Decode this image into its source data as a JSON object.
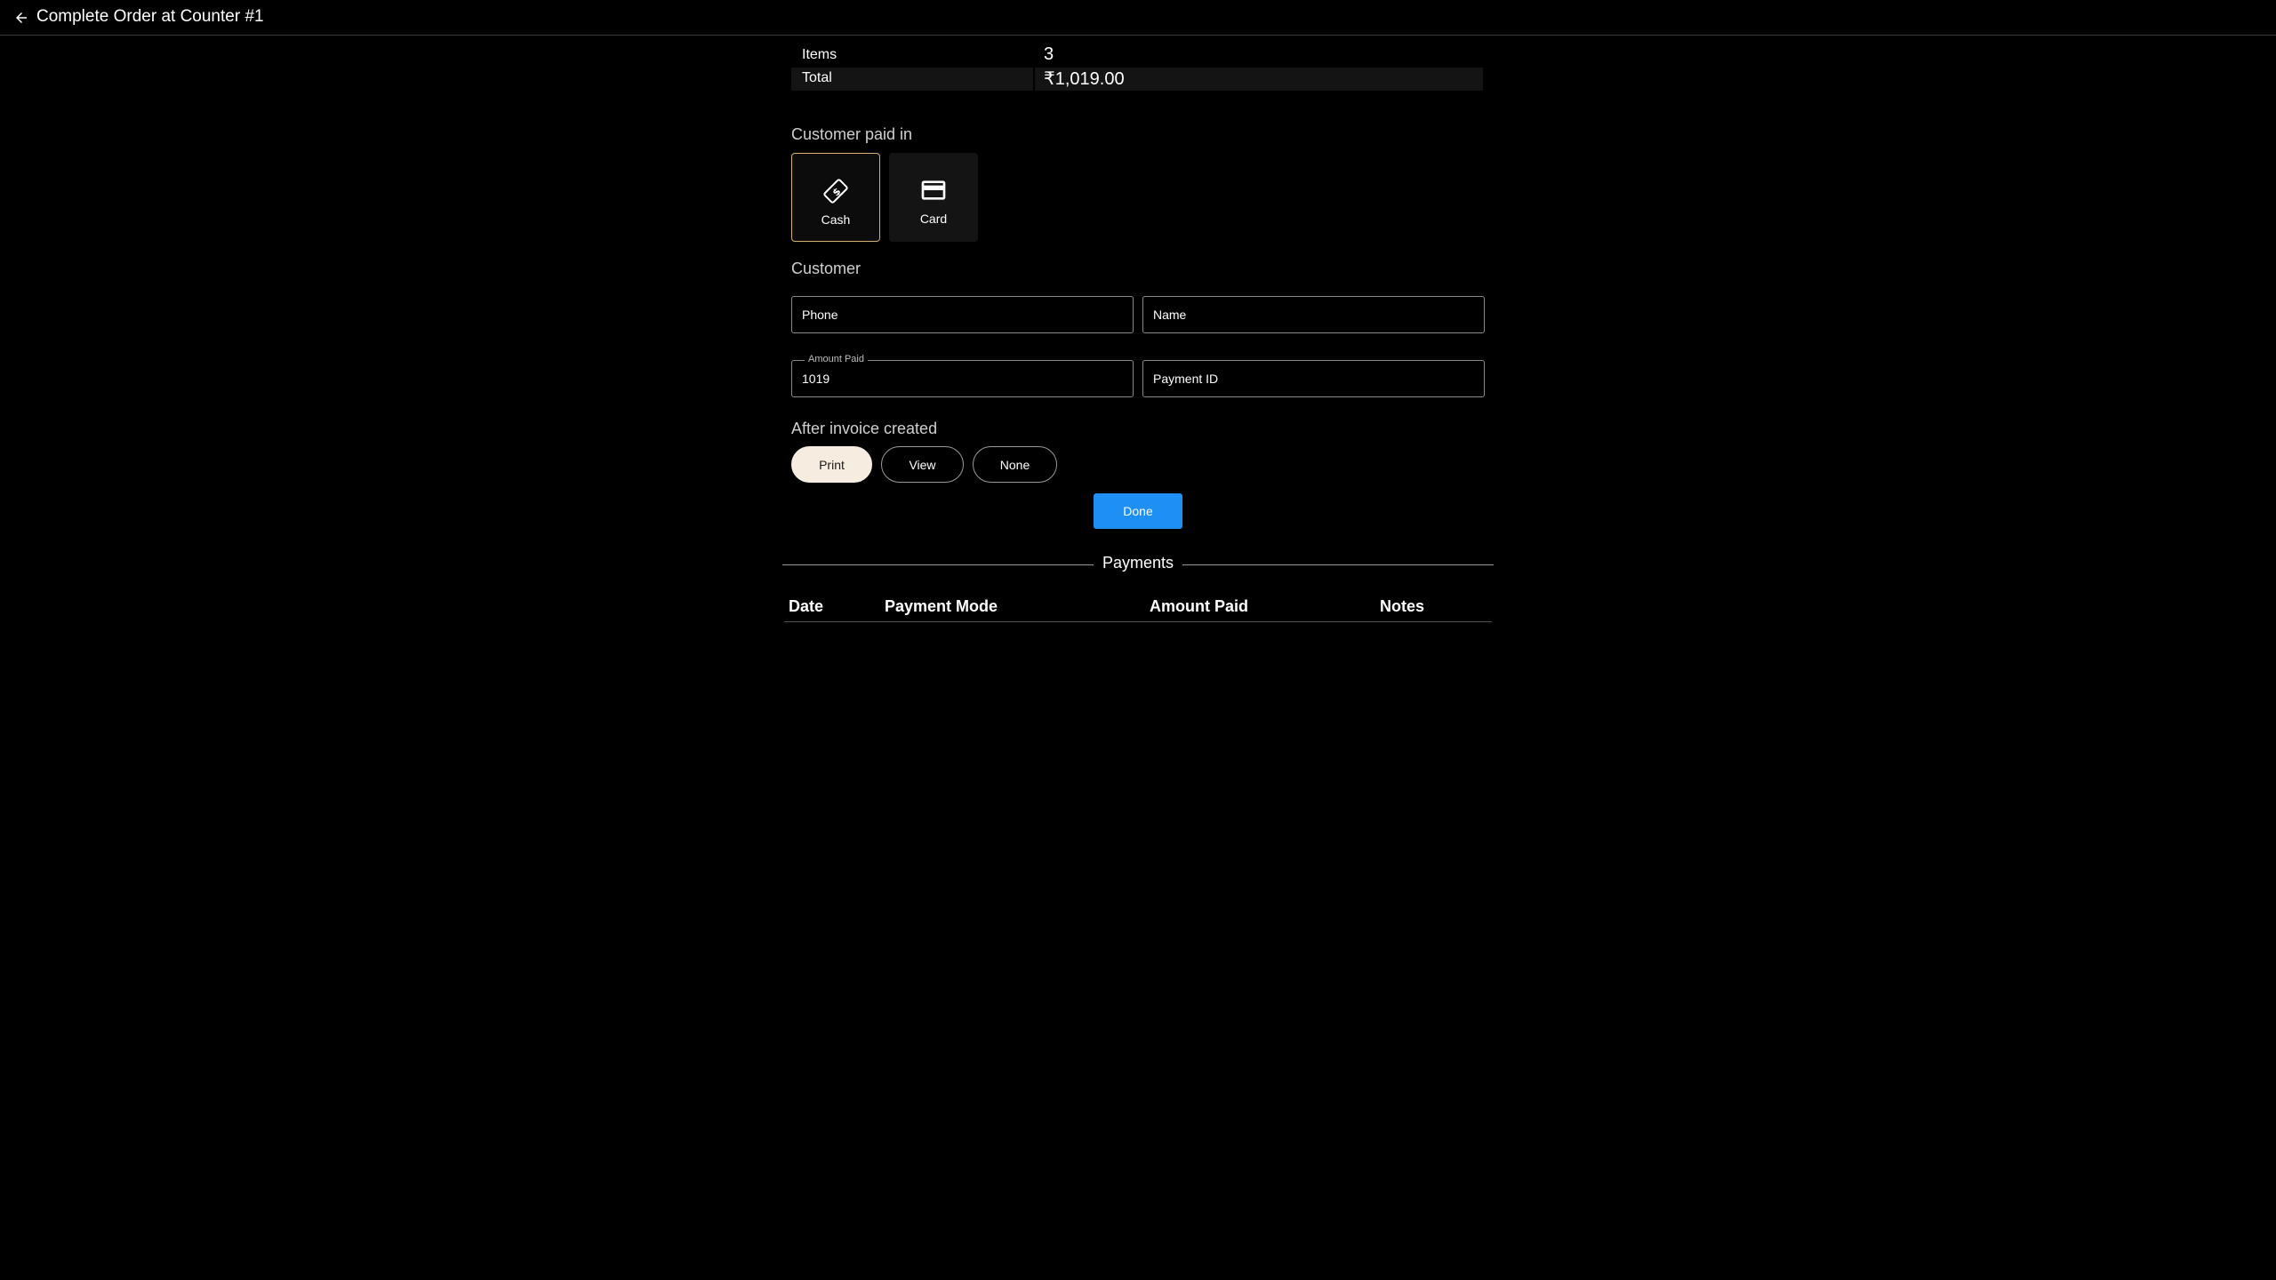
{
  "header": {
    "title": "Complete Order at Counter #1",
    "back_icon": "arrow-left-icon"
  },
  "summary": {
    "items_label": "Items",
    "items_value": "3",
    "total_label": "Total",
    "total_value": "₹1,019.00"
  },
  "payment_method": {
    "label": "Customer paid in",
    "options": [
      {
        "label": "Cash",
        "icon": "cash-icon",
        "selected": true
      },
      {
        "label": "Card",
        "icon": "credit-card-icon",
        "selected": false
      }
    ],
    "selected_border_color": "#d4b06a"
  },
  "customer": {
    "label": "Customer",
    "phone_placeholder": "Phone",
    "name_placeholder": "Name",
    "amount_paid_label": "Amount Paid",
    "amount_paid_value": "1019",
    "payment_id_placeholder": "Payment ID"
  },
  "after_invoice": {
    "label": "After invoice created",
    "options": [
      {
        "label": "Print",
        "selected": true
      },
      {
        "label": "View",
        "selected": false
      },
      {
        "label": "None",
        "selected": false
      }
    ]
  },
  "done_button": {
    "label": "Done",
    "color": "#1e90f5"
  },
  "payments": {
    "label": "Payments",
    "columns": [
      "Date",
      "Payment Mode",
      "Amount Paid",
      "Notes"
    ],
    "rows": []
  }
}
